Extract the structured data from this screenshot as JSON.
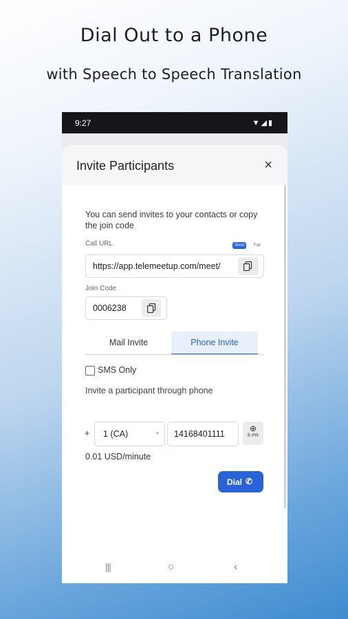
{
  "promo": {
    "headline": "Dial Out to a Phone",
    "subheadline": "with Speech to Speech Translation"
  },
  "status_bar": {
    "time": "9:27",
    "icons": [
      "wifi-icon",
      "signal-icon",
      "battery-icon"
    ]
  },
  "sheet": {
    "title": "Invite Participants",
    "close_icon": "×",
    "intro": "You can send invites to your contacts or copy the join code",
    "call_url": {
      "label": "Call URL",
      "toggle_short": "Short",
      "toggle_full": "Full",
      "selected": "Short",
      "value": "https://app.telemeetup.com/meet/"
    },
    "join_code": {
      "label": "Join Code",
      "value": "0006238"
    },
    "tabs": [
      {
        "label": "Mail Invite",
        "active": false
      },
      {
        "label": "Phone Invite",
        "active": true
      }
    ],
    "sms_only": {
      "label": "SMS Only",
      "checked": false
    },
    "phone_hint": "Invite a participant through phone",
    "phone": {
      "plus": "+",
      "country": "1 (CA)",
      "number": "14168401111",
      "lang_icon": "globe-icon",
      "lang_code": "fr-FR"
    },
    "rate": "0.01 USD/minute",
    "dial_label": "Dial",
    "dial_icon": "phone-icon"
  },
  "colors": {
    "accent": "#2a62d8",
    "tab_active_bg": "#e8f0fb"
  }
}
